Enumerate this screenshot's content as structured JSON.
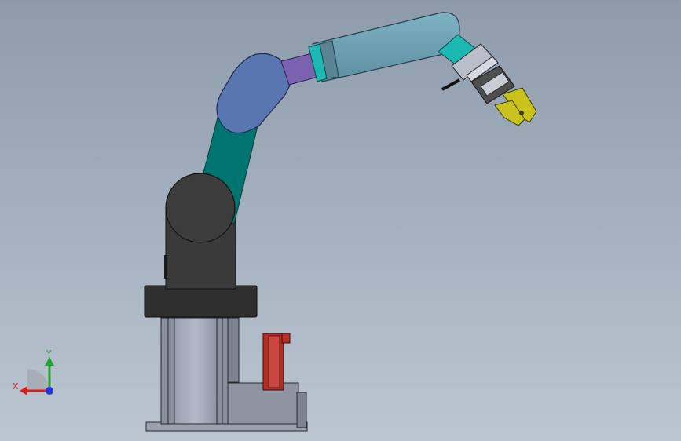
{
  "viewport": {
    "background_top": "#8d9bab",
    "background_bottom": "#bcc6d1"
  },
  "triad": {
    "x_label": "X",
    "y_label": "Y",
    "x_color": "#d21f1f",
    "y_color": "#1fa82f",
    "z_color": "#1f35d4"
  },
  "model": {
    "colors": {
      "base_frame": "#8a8f9e",
      "base_cylinder": "#a8aebd",
      "mount_plate": "#2f2f2f",
      "shoulder_housing": "#3a3a3a",
      "upper_arm": "#00756f",
      "elbow_joint": "#5a76b1",
      "wrist_collar": "#7a62b0",
      "forearm": "#6d9fb2",
      "accent_ring": "#1bb9b2",
      "gripper_fingers": "#c9c21d",
      "control_box": "#b62d24"
    }
  }
}
